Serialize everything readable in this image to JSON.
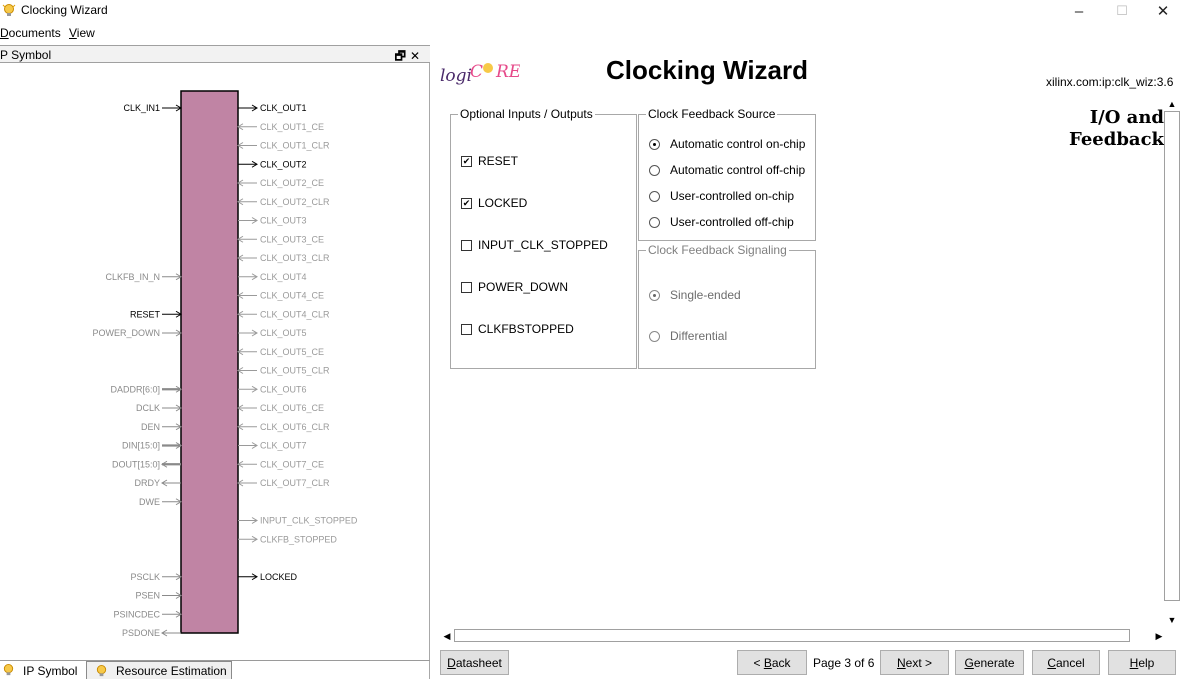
{
  "window": {
    "title": "Clocking Wizard",
    "controls": {
      "minimize": "–",
      "maximize": "☐",
      "close": "✕"
    }
  },
  "menu": [
    {
      "label": "Documents",
      "accel": "D",
      "rest": "ocuments"
    },
    {
      "label": "View",
      "accel": "V",
      "rest": "iew"
    }
  ],
  "left_panel": {
    "title": "P Symbol",
    "header_buttons": "🗗✕",
    "block_color": "#c084a4",
    "symbol": {
      "left_pins": [
        {
          "label": "CLK_IN1",
          "row": 0,
          "active": true
        },
        {
          "label": "CLKFB_IN_N",
          "row": 9,
          "active": false
        },
        {
          "label": "RESET",
          "row": 11,
          "active": true
        },
        {
          "label": "POWER_DOWN",
          "row": 12,
          "active": false
        },
        {
          "label": "DADDR[6:0]",
          "row": 15,
          "active": false,
          "bus": true
        },
        {
          "label": "DCLK",
          "row": 16,
          "active": false
        },
        {
          "label": "DEN",
          "row": 17,
          "active": false
        },
        {
          "label": "DIN[15:0]",
          "row": 18,
          "active": false,
          "bus": true
        },
        {
          "label": "DOUT[15:0]",
          "row": 19,
          "active": false,
          "bus": true,
          "dir": "out"
        },
        {
          "label": "DRDY",
          "row": 20,
          "active": false,
          "dir": "out"
        },
        {
          "label": "DWE",
          "row": 21,
          "active": false
        },
        {
          "label": "PSCLK",
          "row": 25,
          "active": false
        },
        {
          "label": "PSEN",
          "row": 26,
          "active": false
        },
        {
          "label": "PSINCDEC",
          "row": 27,
          "active": false
        },
        {
          "label": "PSDONE",
          "row": 28,
          "active": false,
          "dir": "out"
        }
      ],
      "right_pins": [
        {
          "label": "CLK_OUT1",
          "row": 0,
          "active": true
        },
        {
          "label": "CLK_OUT1_CE",
          "row": 1,
          "active": false,
          "dir": "in"
        },
        {
          "label": "CLK_OUT1_CLR",
          "row": 2,
          "active": false,
          "dir": "in"
        },
        {
          "label": "CLK_OUT2",
          "row": 3,
          "active": true
        },
        {
          "label": "CLK_OUT2_CE",
          "row": 4,
          "active": false,
          "dir": "in"
        },
        {
          "label": "CLK_OUT2_CLR",
          "row": 5,
          "active": false,
          "dir": "in"
        },
        {
          "label": "CLK_OUT3",
          "row": 6,
          "active": false
        },
        {
          "label": "CLK_OUT3_CE",
          "row": 7,
          "active": false,
          "dir": "in"
        },
        {
          "label": "CLK_OUT3_CLR",
          "row": 8,
          "active": false,
          "dir": "in"
        },
        {
          "label": "CLK_OUT4",
          "row": 9,
          "active": false
        },
        {
          "label": "CLK_OUT4_CE",
          "row": 10,
          "active": false,
          "dir": "in"
        },
        {
          "label": "CLK_OUT4_CLR",
          "row": 11,
          "active": false,
          "dir": "in"
        },
        {
          "label": "CLK_OUT5",
          "row": 12,
          "active": false
        },
        {
          "label": "CLK_OUT5_CE",
          "row": 13,
          "active": false,
          "dir": "in"
        },
        {
          "label": "CLK_OUT5_CLR",
          "row": 14,
          "active": false,
          "dir": "in"
        },
        {
          "label": "CLK_OUT6",
          "row": 15,
          "active": false
        },
        {
          "label": "CLK_OUT6_CE",
          "row": 16,
          "active": false,
          "dir": "in"
        },
        {
          "label": "CLK_OUT6_CLR",
          "row": 17,
          "active": false,
          "dir": "in"
        },
        {
          "label": "CLK_OUT7",
          "row": 18,
          "active": false
        },
        {
          "label": "CLK_OUT7_CE",
          "row": 19,
          "active": false,
          "dir": "in"
        },
        {
          "label": "CLK_OUT7_CLR",
          "row": 20,
          "active": false,
          "dir": "in"
        },
        {
          "label": "INPUT_CLK_STOPPED",
          "row": 22,
          "active": false
        },
        {
          "label": "CLKFB_STOPPED",
          "row": 23,
          "active": false
        },
        {
          "label": "LOCKED",
          "row": 25,
          "active": true
        }
      ]
    },
    "tabs": [
      {
        "label": "IP Symbol",
        "selected": true
      },
      {
        "label": "Resource Estimation",
        "selected": false
      }
    ]
  },
  "wizard": {
    "logo_text": "logiCORE",
    "title": "Clocking Wizard",
    "ip_identifier": "xilinx.com:ip:clk_wiz:3.6",
    "section_title_line1": "I/O and",
    "section_title_line2": "Feedback",
    "optional_io": {
      "legend": "Optional Inputs / Outputs",
      "items": [
        {
          "label": "RESET",
          "checked": true
        },
        {
          "label": "LOCKED",
          "checked": true
        },
        {
          "label": "INPUT_CLK_STOPPED",
          "checked": false
        },
        {
          "label": "POWER_DOWN",
          "checked": false
        },
        {
          "label": "CLKFBSTOPPED",
          "checked": false
        }
      ]
    },
    "feedback_source": {
      "legend": "Clock Feedback Source",
      "options": [
        {
          "label": "Automatic control on-chip",
          "selected": true
        },
        {
          "label": "Automatic control off-chip",
          "selected": false
        },
        {
          "label": "User-controlled on-chip",
          "selected": false
        },
        {
          "label": "User-controlled off-chip",
          "selected": false
        }
      ]
    },
    "feedback_signaling": {
      "legend": "Clock Feedback Signaling",
      "enabled": false,
      "options": [
        {
          "label": "Single-ended",
          "selected": true
        },
        {
          "label": "Differential",
          "selected": false
        }
      ]
    }
  },
  "footer": {
    "datasheet": {
      "accel": "D",
      "rest": "atasheet"
    },
    "back": {
      "prefix": "< ",
      "accel": "B",
      "rest": "ack"
    },
    "page": "Page 3 of 6",
    "next": {
      "accel": "N",
      "rest": "ext >"
    },
    "generate": {
      "accel": "G",
      "rest": "enerate"
    },
    "cancel": {
      "accel": "C",
      "rest": "ancel"
    },
    "help": {
      "accel": "H",
      "rest": "elp"
    }
  }
}
